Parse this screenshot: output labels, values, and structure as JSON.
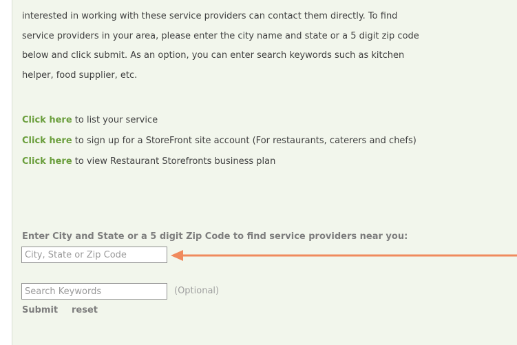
{
  "intro": {
    "line1": "interested in working with these service providers can contact them directly. To find",
    "line2": "service providers in your area, please enter the city name and state or a 5 digit zip code",
    "line3": "below and click submit. As an option, you can enter search keywords such as kitchen",
    "line4": "helper, food supplier, etc."
  },
  "links": [
    {
      "link_text": "Click here",
      "rest": " to list your service"
    },
    {
      "link_text": "Click here",
      "rest": " to sign up for a StoreFront site account (For restaurants, caterers and chefs)"
    },
    {
      "link_text": "Click here",
      "rest": " to view Restaurant Storefronts business plan"
    }
  ],
  "search": {
    "label": "Enter City and State or a 5 digit Zip Code to find service providers near you:",
    "city_placeholder": "City, State or Zip Code",
    "keywords_placeholder": "Search Keywords",
    "optional_note": "(Optional)",
    "submit_label": "Submit",
    "reset_label": "reset"
  },
  "colors": {
    "background": "#f2f6ec",
    "link": "#6a9e3c",
    "arrow": "#f08a5d"
  },
  "annotation": {
    "arrow_icon": "left-arrow-icon"
  }
}
